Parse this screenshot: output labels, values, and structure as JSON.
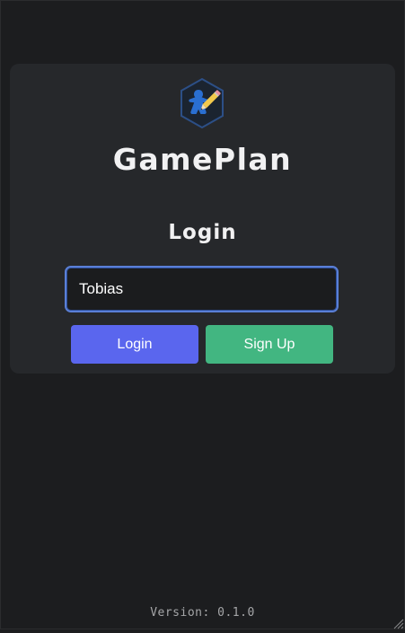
{
  "app": {
    "title": "GamePlan",
    "logo_icon": "meeple-pencil-icon"
  },
  "login": {
    "heading": "Login",
    "username_value": "Tobias",
    "login_button": "Login",
    "signup_button": "Sign Up"
  },
  "footer": {
    "version": "Version: 0.1.0"
  },
  "colors": {
    "background": "#1c1d1f",
    "card": "#26282b",
    "login_button": "#5a66ee",
    "signup_button": "#42b681",
    "input_focus_border": "#5a7fd6"
  }
}
